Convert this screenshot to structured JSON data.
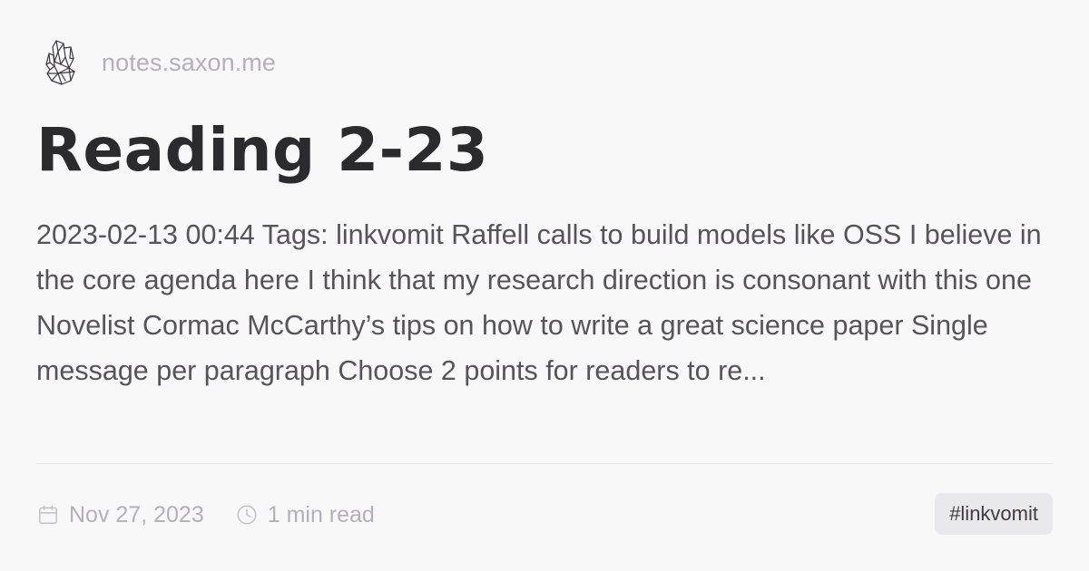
{
  "site": {
    "logo_icon": "crystal-cluster-icon",
    "name": "notes.saxon.me"
  },
  "post": {
    "title": "Reading 2-23",
    "excerpt": "2023-02-13 00:44 Tags: linkvomit Raffell calls to build models like OSS I believe in the core agenda here I think that my research direction is consonant with this one Novelist Cormac McCarthy’s tips on how to write a great science paper Single message per paragraph Choose 2 points for readers to re..."
  },
  "meta": {
    "date_icon": "calendar-icon",
    "date": "Nov 27, 2023",
    "read_icon": "clock-icon",
    "read_time": "1 min read"
  },
  "tag": {
    "label": "#linkvomit"
  },
  "colors": {
    "background": "#f9f8f9",
    "title": "#2b2a2d",
    "body_text": "#565459",
    "muted": "#b3b1b5",
    "tag_bg": "#e9e8ec"
  }
}
